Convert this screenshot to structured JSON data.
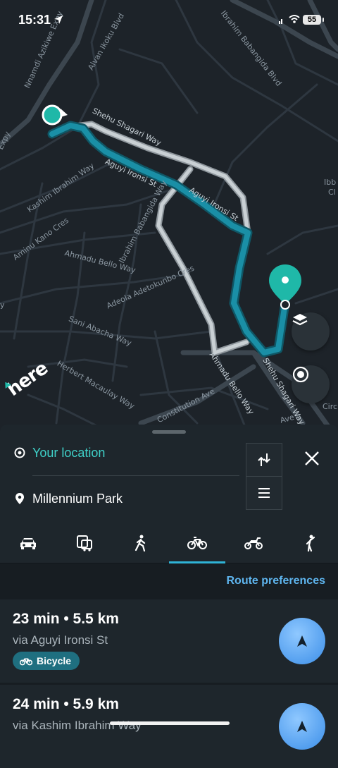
{
  "status_bar": {
    "time": "15:31",
    "battery": "55"
  },
  "map": {
    "streets": [
      "Nnamdi Azikiwe Expy",
      "Alvan Ikoku Blvd",
      "Ibrahim Babangida Blvd",
      "Shehu Shagari Way",
      "Expy",
      "Kashim Ibrahim Way",
      "Aguyi Ironsi St",
      "Aguyi Ironsi St",
      "Ibrahim Babangida Way",
      "Aminu Kano Cres",
      "Ahmadu Bello Way",
      "Adeola Adetokunbo Cres",
      "Sani Abacha Way",
      "Herbert Macaulay Way",
      "Ahmadu Bello Way",
      "Shehu Shagari Way",
      "Constitution Ave",
      "Ave",
      "Circ",
      "Ibb",
      "Cl",
      "y"
    ],
    "logo": "here"
  },
  "route_planner": {
    "origin": "Your location",
    "destination": "Millennium Park",
    "modes": [
      "car",
      "truck",
      "walk",
      "bicycle",
      "scooter",
      "pedestrian"
    ],
    "active_mode": "bicycle",
    "preferences_label": "Route preferences",
    "routes": [
      {
        "summary": "23 min • 5.5 km",
        "via": "via Aguyi Ironsi St",
        "badge": "Bicycle"
      },
      {
        "summary": "24 min • 5.9 km",
        "via": "via Kashim Ibrahim Way"
      }
    ]
  },
  "colors": {
    "accent": "#2fb3d6",
    "route": "#1a8fa6",
    "link": "#5fb6f0",
    "origin_text": "#3fd0c8"
  }
}
